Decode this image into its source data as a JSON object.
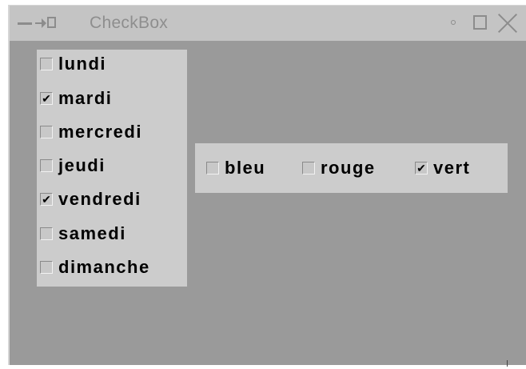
{
  "window": {
    "title": "CheckBox"
  },
  "days": [
    {
      "label": "lundi",
      "checked": false
    },
    {
      "label": "mardi",
      "checked": true
    },
    {
      "label": "mercredi",
      "checked": false
    },
    {
      "label": "jeudi",
      "checked": false
    },
    {
      "label": "vendredi",
      "checked": true
    },
    {
      "label": "samedi",
      "checked": false
    },
    {
      "label": "dimanche",
      "checked": false
    }
  ],
  "colors": [
    {
      "label": "bleu",
      "checked": false
    },
    {
      "label": "rouge",
      "checked": false
    },
    {
      "label": "vert",
      "checked": true
    }
  ],
  "icons": {
    "titlebar": [
      "menu-icon",
      "pin-icon",
      "minimize-icon",
      "maximize-icon",
      "close-icon"
    ],
    "check_glyph": "✔"
  },
  "theme": {
    "window_bg": "#9a9a9a",
    "panel_bg": "#cccccc",
    "titlebar_bg": "#c4c4c4"
  }
}
